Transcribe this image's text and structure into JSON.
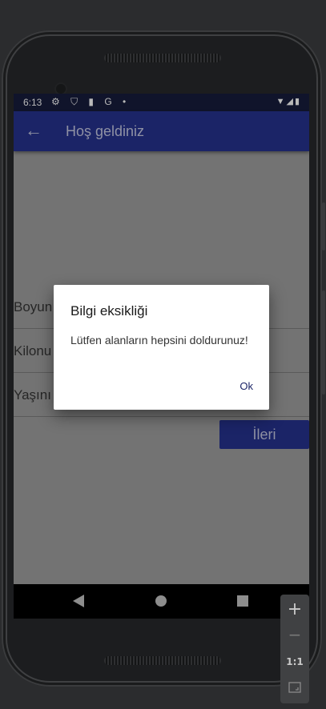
{
  "status_bar": {
    "time": "6:13",
    "left_icons": "⚙ ⛉ ▮ G •",
    "right_icons": "▼◢▮"
  },
  "app_bar": {
    "title": "Hoş geldiniz"
  },
  "form": {
    "fields": [
      {
        "label": "Boyun"
      },
      {
        "label": "Kilonu"
      },
      {
        "label": "Yaşını"
      }
    ],
    "next_button": "İleri"
  },
  "dialog": {
    "title": "Bilgi eksikliği",
    "message": "Lütfen alanların hepsini doldurunuz!",
    "ok_button": "Ok"
  },
  "zoom_controls": {
    "zoom_in": "+",
    "zoom_out": "−",
    "actual_size": "1:1"
  },
  "colors": {
    "primary": "#1b2467",
    "status_bar": "#10142b",
    "scrim_background": "#737373"
  }
}
